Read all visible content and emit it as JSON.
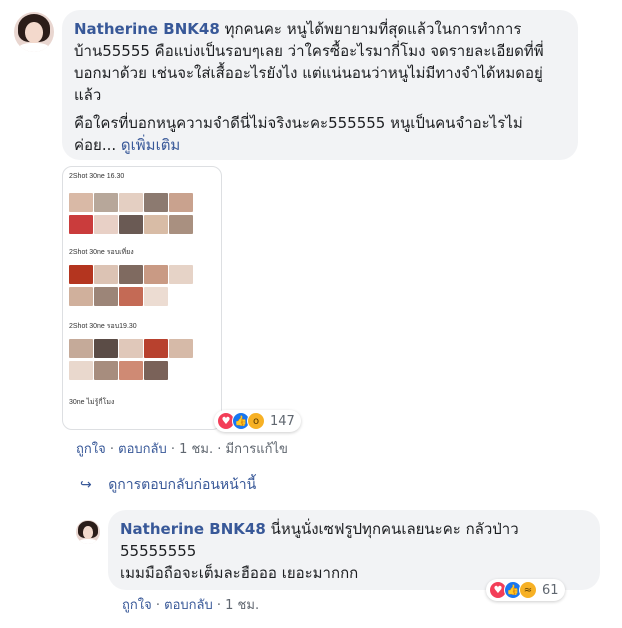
{
  "comment1": {
    "author": "Natherine BNK48",
    "text_p1": "ทุกคนคะ หนูได้พยายามที่สุดแล้วในการทำการบ้าน55555 คือแบ่งเป็นรอบๆเลย ว่าใครซื้อะไรมากี่โมง จดรายละเอียดที่พี่บอกมาด้วย เช่นจะใส่เสื้ออะไรยังไง แต่แน่นอนว่าหนูไม่มีทางจำได้หมดอยู่แล้ว",
    "text_p2": "คือใครที่บอกหนูความจำดีนี่ไม่จริงนะคะ555555 หนูเป็นคนจำอะไรไม่ค่อย...",
    "see_more": "ดูเพิ่มเติม",
    "photo_labels": [
      "2Shot 30ne 16.30",
      "2Shot 30ne รอบเที่ยง",
      "2Shot 30ne รอบ19.30",
      "30ne ไม่รู้กี่โมง"
    ],
    "reaction_count": "147",
    "like": "ถูกใจ",
    "reply": "ตอบกลับ",
    "time": "1 ชม.",
    "edited": "มีการแก้ไข",
    "sep": "·"
  },
  "view_previous": "ดูการตอบกลับก่อนหน้านี้",
  "comment2": {
    "author": "Natherine BNK48",
    "text_l1": "นี่หนูนั่งเซฟรูปทุกคนเลยนะคะ กลัวป่าว 55555555",
    "text_l2": "เมมมือถือจะเต็มละฮือออ เยอะมากกก",
    "reaction_count": "61",
    "like": "ถูกใจ",
    "reply": "ตอบกลับ",
    "time": "1 ชม.",
    "sep": "·"
  },
  "colors": {
    "link": "#385898",
    "bubble": "#f2f3f5",
    "love": "#f33e58",
    "like": "#1877f2",
    "wow": "#f7b125"
  },
  "icons": [
    "love-reaction-icon",
    "like-reaction-icon",
    "wow-reaction-icon",
    "haha-reaction-icon",
    "reply-arrow-icon"
  ]
}
